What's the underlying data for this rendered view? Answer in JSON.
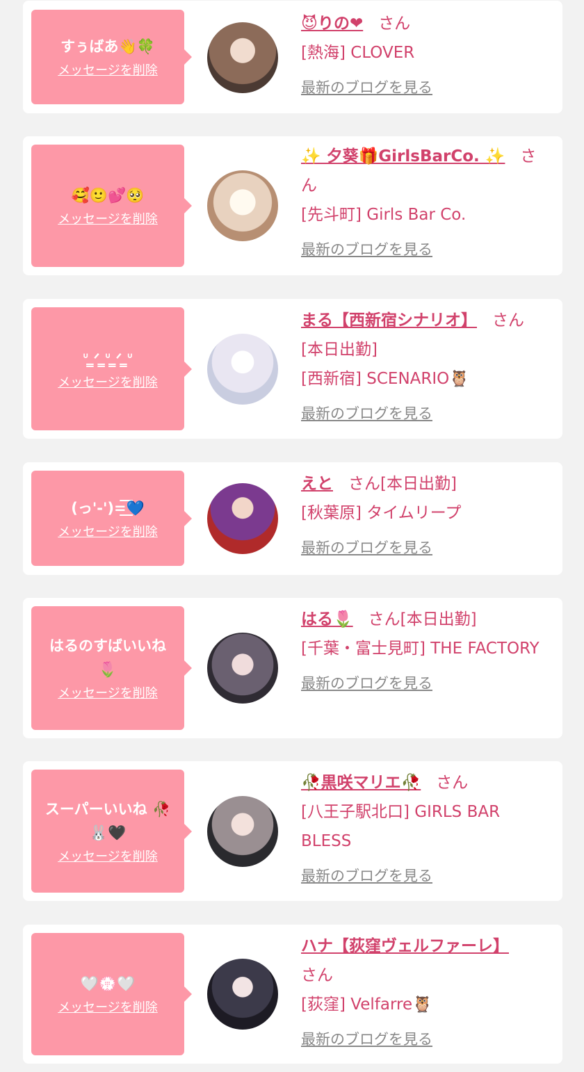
{
  "delete_label": "メッセージを削除",
  "blog_label": "最新のブログを見る",
  "honorific": "さん",
  "cards": [
    {
      "message": "すぅばあ👋🍀",
      "name": "😈りの❤",
      "status": "",
      "shop": "[熱海] CLOVER"
    },
    {
      "message": "🥰🙂💕🥺",
      "name": "✨ 夕葵🎁GirlsBarCo. ✨",
      "status": "",
      "shop": "[先斗町] Girls Bar Co."
    },
    {
      "message": "ᐡ ̳ᐟ ̳ᐡ ̳ᐟ ̳ᐡ",
      "name": "まる【西新宿シナリオ】",
      "status": "[本日出勤]",
      "shop": "[西新宿] SCENARIO🦉"
    },
    {
      "message": "(っ'-')=͟͟͞💙",
      "name": "えと",
      "status": "[本日出勤]",
      "shop": "[秋葉原] タイムリープ"
    },
    {
      "message": "はるのすばいいね\n🌷",
      "name": "はる🌷",
      "status": "[本日出勤]",
      "shop": "[千葉・富士見町] THE FACTORY"
    },
    {
      "message": "スーパーいいね 🥀\n🐰🖤",
      "name": "🥀黒咲マリエ🥀",
      "status": "",
      "shop": "[八王子駅北口] GIRLS BAR BLESS"
    },
    {
      "message": "🤍💮🤍",
      "name": "ハナ【荻窪ヴェルファーレ】",
      "status": "",
      "shop": "[荻窪] Velfarre🦉"
    }
  ],
  "colors": {
    "accent": "#d1416b",
    "bubble": "#fd98a7",
    "background": "#f2f2f2",
    "card": "#ffffff",
    "link_gray": "#888888"
  }
}
